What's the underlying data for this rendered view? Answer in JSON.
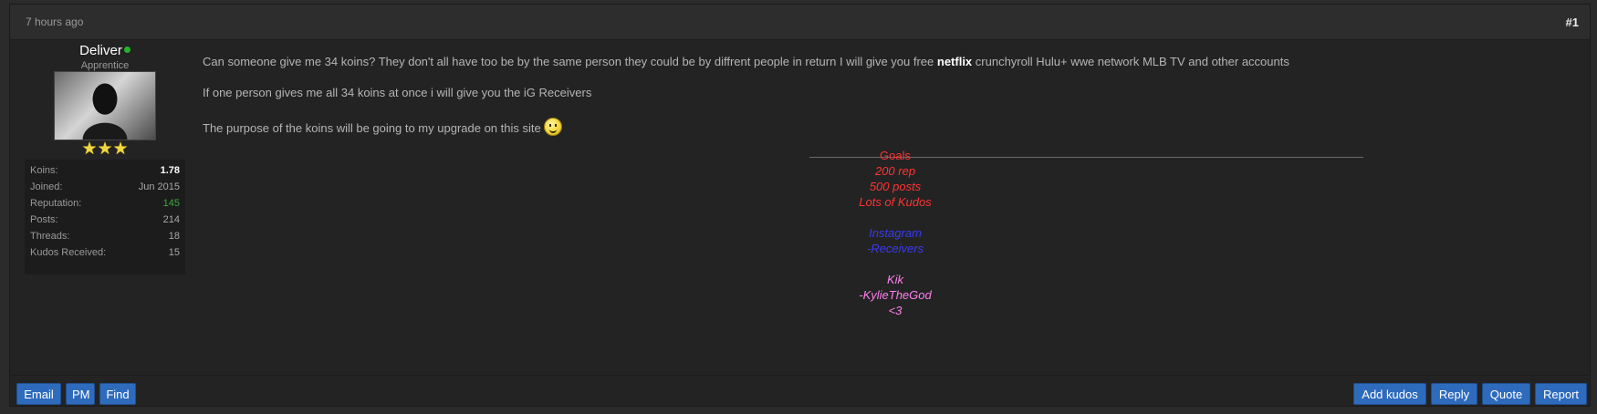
{
  "post": {
    "time": "7 hours ago",
    "number": "#1"
  },
  "author": {
    "name": "Deliver",
    "rank": "Apprentice",
    "stats": [
      {
        "label": "Koins:",
        "value": "1.78"
      },
      {
        "label": "Joined:",
        "value": "Jun 2015"
      },
      {
        "label": "Reputation:",
        "value": "145"
      },
      {
        "label": "Posts:",
        "value": "214"
      },
      {
        "label": "Threads:",
        "value": "18"
      },
      {
        "label": "Kudos Received:",
        "value": "15"
      }
    ],
    "stars": "★★★",
    "star_count": 3
  },
  "message": {
    "p1_before": "Can someone give me 34 koins? They don't all have too be by the same person they could be by diffrent people in return I will give you free ",
    "p1_highlight": "netflix",
    "p1_after": " crunchyroll Hulu+ wwe network MLB TV and other accounts",
    "p2": "If one person gives me all 34 koins at once i will give you the iG Receivers",
    "p3": "The purpose of the koins will be going to my upgrade on this site",
    "smiley": "smiley-icon"
  },
  "signature": {
    "goals_title": "Goals",
    "goals": [
      "200 rep",
      "500 posts",
      "Lots of Kudos"
    ],
    "instagram_title": "Instagram",
    "instagram_handle": "-Receivers",
    "kik_title": "Kik",
    "kik_handle": "-KylieTheGod",
    "heart": "<3",
    "colors": {
      "red": "#ff3333",
      "blue": "#3a3af0",
      "pink": "#ff80ee"
    }
  },
  "footer": {
    "left_buttons": [
      "Email",
      "PM",
      "Find"
    ],
    "right_buttons": [
      "Add kudos",
      "Reply",
      "Quote",
      "Report"
    ],
    "button_color": "#2e6bbd"
  }
}
